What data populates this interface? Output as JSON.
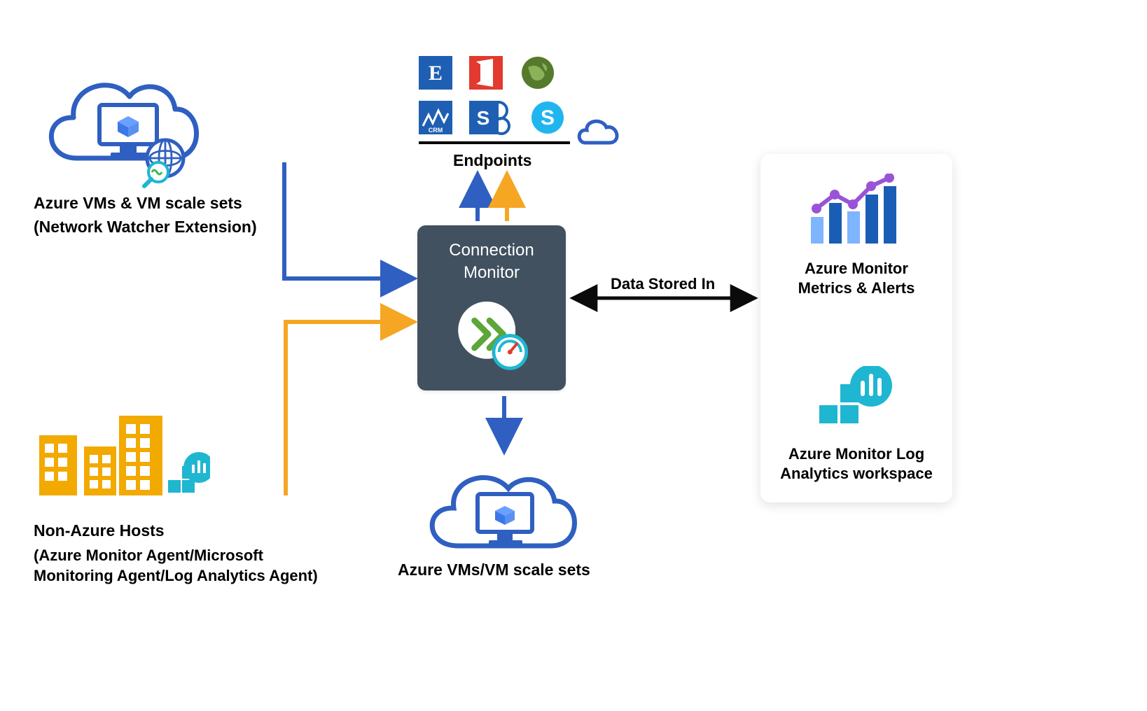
{
  "nodes": {
    "azure_vms_source": {
      "title": "Azure VMs & VM scale sets",
      "subtitle": "(Network Watcher Extension)"
    },
    "non_azure_hosts": {
      "title": "Non-Azure Hosts",
      "subtitle": "(Azure Monitor Agent/Microsoft Monitoring Agent/Log Analytics Agent)"
    },
    "connection_monitor": {
      "title_line1": "Connection",
      "title_line2": "Monitor"
    },
    "endpoints": {
      "title": "Endpoints",
      "icons": [
        "exchange",
        "office",
        "globe",
        "crm",
        "sharepoint",
        "skype"
      ]
    },
    "azure_vms_dest": {
      "title": "Azure VMs/VM scale sets"
    },
    "data_stored": {
      "label": "Data Stored In"
    },
    "panel": {
      "metrics": "Azure Monitor Metrics & Alerts",
      "logs": "Azure Monitor Log Analytics workspace"
    }
  },
  "colors": {
    "blue": "#2f5fc1",
    "orange": "#f5a623",
    "dark": "#0b0b0b",
    "teal": "#1fb6d1",
    "box": "#415160",
    "buildingYellow": "#f2a900",
    "green": "#5ca63a",
    "red": "#e23a2e",
    "purple": "#9a53d8"
  }
}
